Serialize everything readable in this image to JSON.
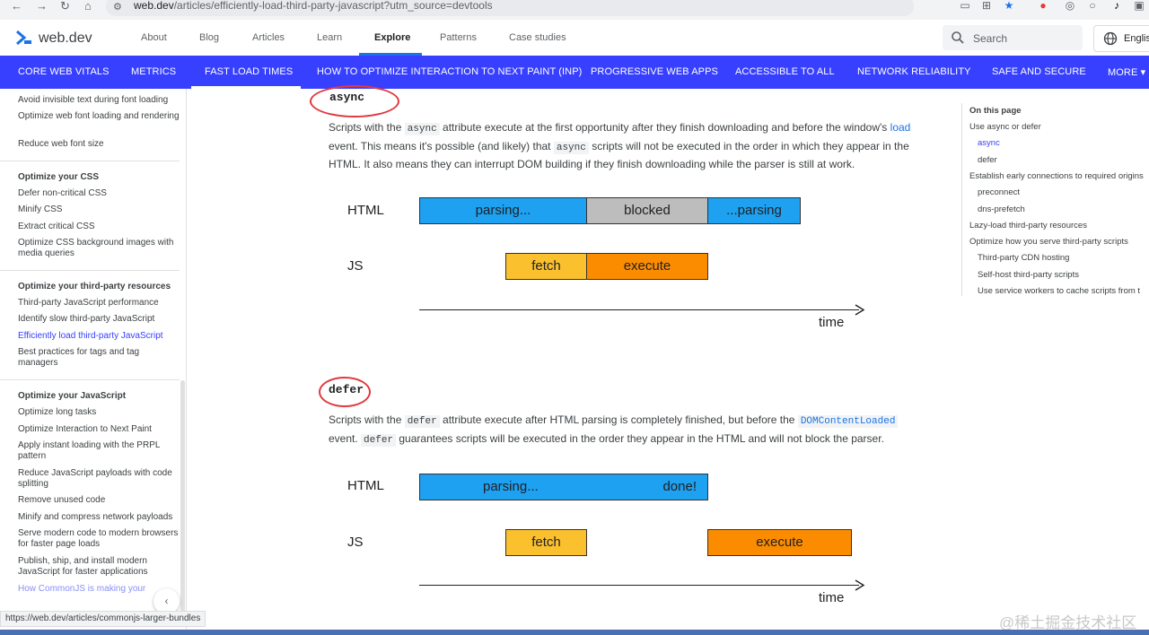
{
  "browser": {
    "url_host": "web.dev",
    "url_rest": "/articles/efficiently-load-third-party-javascript?utm_source=devtools",
    "status_url": "https://web.dev/articles/commonjs-larger-bundles"
  },
  "header": {
    "logo_text": "web.dev",
    "nav": [
      "About",
      "Blog",
      "Articles",
      "Learn",
      "Explore",
      "Patterns",
      "Case studies"
    ],
    "active_nav": "Explore",
    "search_placeholder": "Search",
    "language_label": "Englis"
  },
  "categories": [
    "CORE WEB VITALS",
    "METRICS",
    "FAST LOAD TIMES",
    "HOW TO OPTIMIZE INTERACTION TO NEXT PAINT (INP)",
    "PROGRESSIVE WEB APPS",
    "ACCESSIBLE TO ALL",
    "NETWORK RELIABILITY",
    "SAFE AND SECURE",
    "MORE"
  ],
  "active_category": "FAST LOAD TIMES",
  "sidebar": {
    "items": [
      {
        "label": "Avoid invisible text during font loading"
      },
      {
        "label": "Optimize web font loading and rendering"
      },
      {
        "label": "Reduce web font size"
      },
      {
        "label": "Optimize your CSS",
        "heading": true
      },
      {
        "label": "Defer non-critical CSS"
      },
      {
        "label": "Minify CSS"
      },
      {
        "label": "Extract critical CSS"
      },
      {
        "label": "Optimize CSS background images with media queries"
      },
      {
        "label": "Optimize your third-party resources",
        "heading": true
      },
      {
        "label": "Third-party JavaScript performance"
      },
      {
        "label": "Identify slow third-party JavaScript"
      },
      {
        "label": "Efficiently load third-party JavaScript",
        "current": true
      },
      {
        "label": "Best practices for tags and tag managers"
      },
      {
        "label": "Optimize your JavaScript",
        "heading": true
      },
      {
        "label": "Optimize long tasks"
      },
      {
        "label": "Optimize Interaction to Next Paint"
      },
      {
        "label": "Apply instant loading with the PRPL pattern"
      },
      {
        "label": "Reduce JavaScript payloads with code splitting"
      },
      {
        "label": "Remove unused code"
      },
      {
        "label": "Minify and compress network payloads"
      },
      {
        "label": "Serve modern code to modern browsers for faster page loads"
      },
      {
        "label": "Publish, ship, and install modern JavaScript for faster applications"
      },
      {
        "label": "How CommonJS is making your"
      }
    ]
  },
  "async_section": {
    "heading": "async",
    "p_part1": "Scripts with the ",
    "code1": "async",
    "p_part2": " attribute execute at the first opportunity after they finish downloading and before the window's ",
    "link": "load",
    "p_part3": " event. This means it's possible (and likely) that ",
    "code2": "async",
    "p_part4": " scripts will not be executed in the order in which they appear in the HTML. It also means they can interrupt DOM building if they finish downloading while the parser is still at work.",
    "diagram": {
      "html_label": "HTML",
      "js_label": "JS",
      "bar_parsing": "parsing...",
      "bar_blocked": "blocked",
      "bar_parsing2": "...parsing",
      "bar_fetch": "fetch",
      "bar_execute": "execute",
      "time_label": "time"
    }
  },
  "defer_section": {
    "heading": "defer",
    "p_part1": "Scripts with the ",
    "code1": "defer",
    "p_part2": " attribute execute after HTML parsing is completely finished, but before the ",
    "code_link": "DOMContentLoaded",
    "p_part3": " event. ",
    "code2": "defer",
    "p_part4": " guarantees scripts will be executed in the order they appear in the HTML and will not block the parser.",
    "diagram": {
      "html_label": "HTML",
      "js_label": "JS",
      "bar_parsing": "parsing...",
      "bar_done": "done!",
      "bar_fetch": "fetch",
      "bar_execute": "execute",
      "time_label": "time"
    }
  },
  "toc": {
    "title": "On this page",
    "items": [
      {
        "label": "Use async or defer",
        "indent": 0
      },
      {
        "label": "async",
        "indent": 1,
        "current": true
      },
      {
        "label": "defer",
        "indent": 1
      },
      {
        "label": "Establish early connections to required origins",
        "indent": 0
      },
      {
        "label": "preconnect",
        "indent": 1
      },
      {
        "label": "dns-prefetch",
        "indent": 1
      },
      {
        "label": "Lazy-load third-party resources",
        "indent": 0
      },
      {
        "label": "Optimize how you serve third-party scripts",
        "indent": 0
      },
      {
        "label": "Third-party CDN hosting",
        "indent": 1
      },
      {
        "label": "Self-host third-party scripts",
        "indent": 1
      },
      {
        "label": "Use service workers to cache scripts from t",
        "indent": 1
      }
    ]
  },
  "watermark": "@稀土掘金技术社区"
}
